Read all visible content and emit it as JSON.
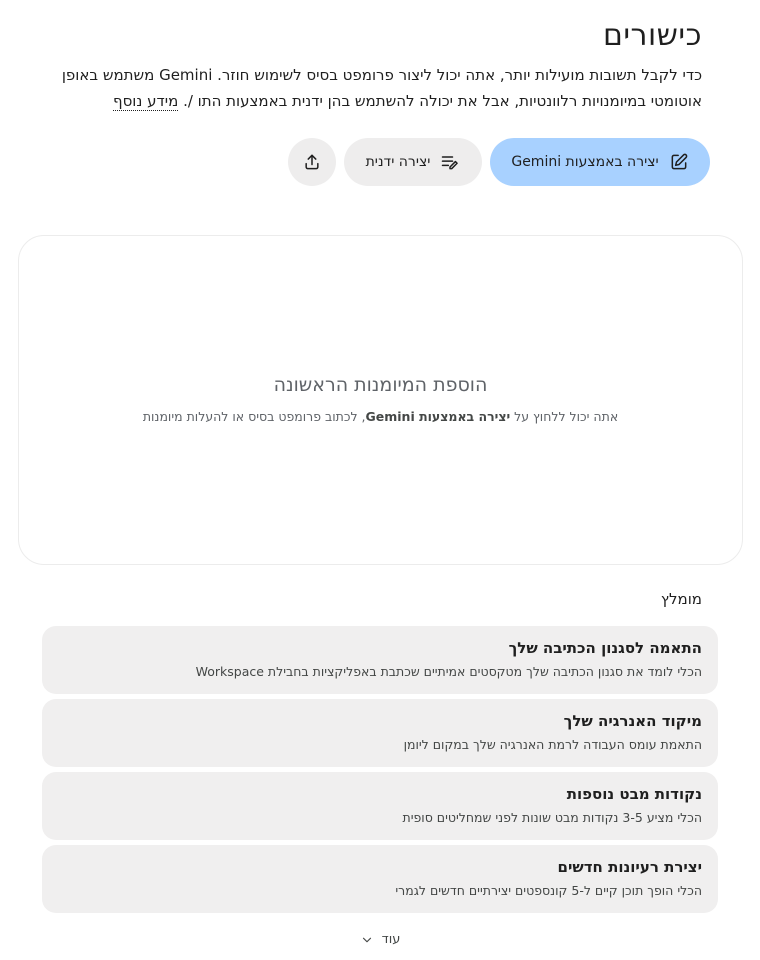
{
  "page": {
    "title": "כישורים",
    "description_part1": "כדי לקבל תשובות מועילות יותר, אתה יכול ליצור פרומפט בסיס לשימוש חוזר. Gemini משתמש באופן אוטומטי במיומנויות רלוונטיות, אבל את יכולה להשתמש בהן ידנית באמצעות התו /.",
    "learn_more": "מידע נוסף"
  },
  "actions": {
    "create_with_gemini": "יצירה באמצעות Gemini",
    "create_manual": "יצירה ידנית",
    "upload_icon": "upload-icon"
  },
  "empty_state": {
    "title": "הוספת המיומנות הראשונה",
    "sub_prefix": "אתה יכול ללחוץ על ",
    "sub_bold": "יצירה באמצעות Gemini",
    "sub_suffix": ", לכתוב פרומפט בסיס או להעלות מיומנות"
  },
  "recommended": {
    "label": "מומלץ",
    "items": [
      {
        "title": "התאמה לסגנון הכתיבה שלך",
        "desc": "הכלי לומד את סגנון הכתיבה שלך מטקסטים אמיתיים שכתבת באפליקציות בחבילת Workspace"
      },
      {
        "title": "מיקוד האנרגיה שלך",
        "desc": "התאמת עומס העבודה לרמת האנרגיה שלך במקום ליומן"
      },
      {
        "title": "נקודות מבט נוספות",
        "desc": "הכלי מציע 3-5 נקודות מבט שונות לפני שמחליטים סופית"
      },
      {
        "title": "יצירת רעיונות חדשים",
        "desc": "הכלי הופך תוכן קיים ל-5 קונספטים יצירתיים חדשים לגמרי"
      }
    ]
  },
  "more": {
    "label": "עוד"
  },
  "colors": {
    "primary_button": "#a8d1ff",
    "secondary_button": "#eeeded",
    "card_bg": "#f0efef"
  }
}
